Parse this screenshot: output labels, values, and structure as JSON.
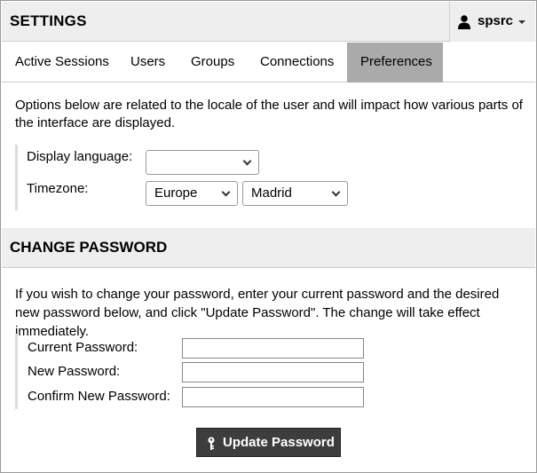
{
  "header": {
    "title": "SETTINGS",
    "user": {
      "name": "spsrc",
      "icon": "user-icon"
    }
  },
  "tabs": [
    {
      "label": "Active Sessions",
      "active": false
    },
    {
      "label": "Users",
      "active": false
    },
    {
      "label": "Groups",
      "active": false
    },
    {
      "label": "Connections",
      "active": false
    },
    {
      "label": "Preferences",
      "active": true
    }
  ],
  "preferences": {
    "intro": "Options below are related to the locale of the user and will impact how various parts of the interface are displayed.",
    "display_language": {
      "label": "Display language:",
      "value": ""
    },
    "timezone": {
      "label": "Timezone:",
      "region": "Europe",
      "city": "Madrid"
    }
  },
  "change_password": {
    "title": "CHANGE PASSWORD",
    "intro": "If you wish to change your password, enter your current password and the desired new password below, and click \"Update Password\". The change will take effect immediately.",
    "fields": [
      {
        "label": "Current Password:",
        "value": ""
      },
      {
        "label": "New Password:",
        "value": ""
      },
      {
        "label": "Confirm New Password:",
        "value": ""
      }
    ],
    "button_label": "Update Password",
    "button_icon": "key-icon"
  }
}
